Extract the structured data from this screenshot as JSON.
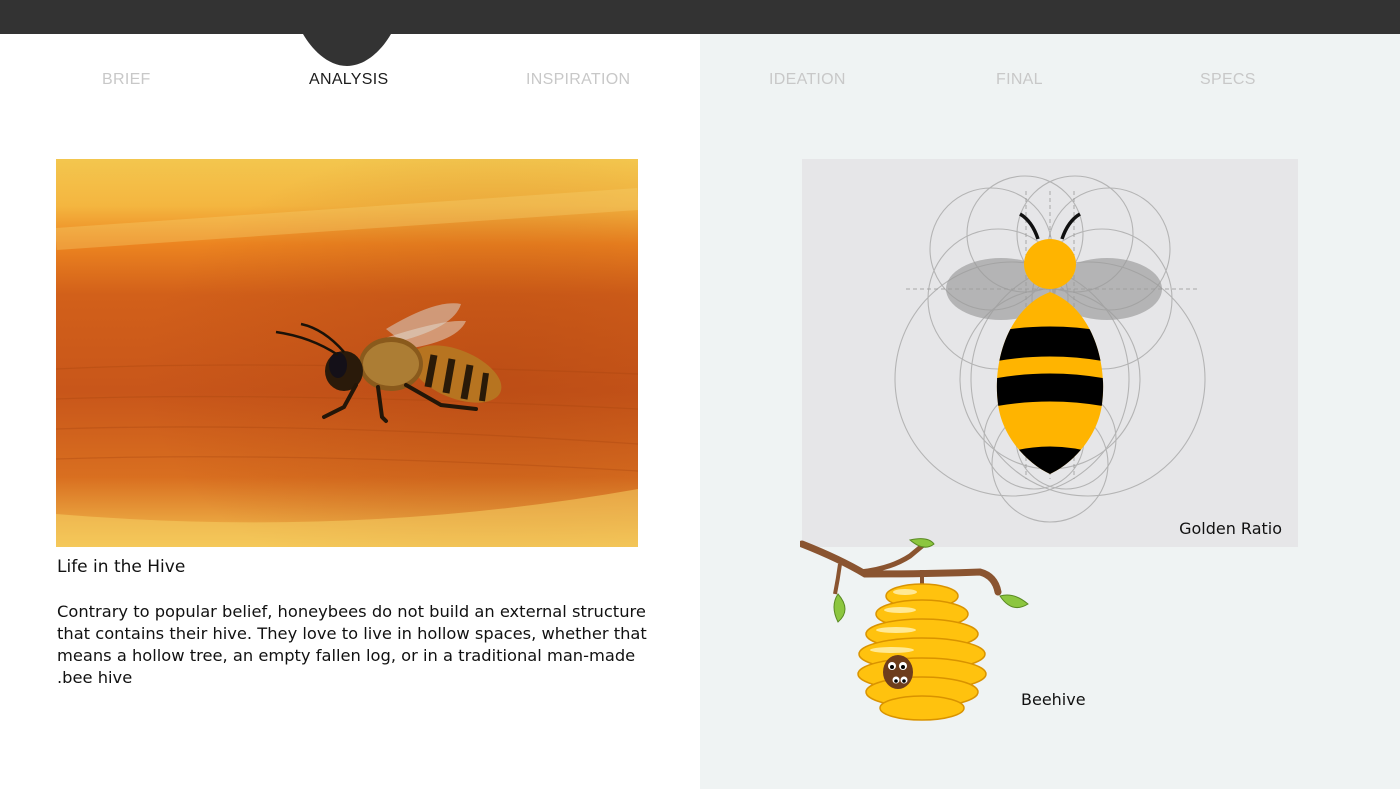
{
  "nav": {
    "tabs": [
      {
        "label": "BRIEF",
        "active": false
      },
      {
        "label": "ANALYSIS",
        "active": true
      },
      {
        "label": "INSPIRATION",
        "active": false
      },
      {
        "label": "IDEATION",
        "active": false
      },
      {
        "label": "FINAL",
        "active": false
      },
      {
        "label": "SPECS",
        "active": false
      }
    ]
  },
  "article": {
    "title": "Life in the Hive",
    "body": "Contrary to popular belief, honeybees do not build an external structure that contains their hive. They love to live in hollow spaces, whether that means a hollow tree, an empty fallen log, or in a traditional man-made .bee hive"
  },
  "figures": {
    "golden_caption": "Golden Ratio",
    "hive_caption": "Beehive"
  },
  "colors": {
    "topbar": "#333333",
    "right_panel": "#eff3f3",
    "bee_yellow": "#ffb400",
    "tab_inactive": "#c8c8c8",
    "tab_active": "#1c1c1c"
  }
}
